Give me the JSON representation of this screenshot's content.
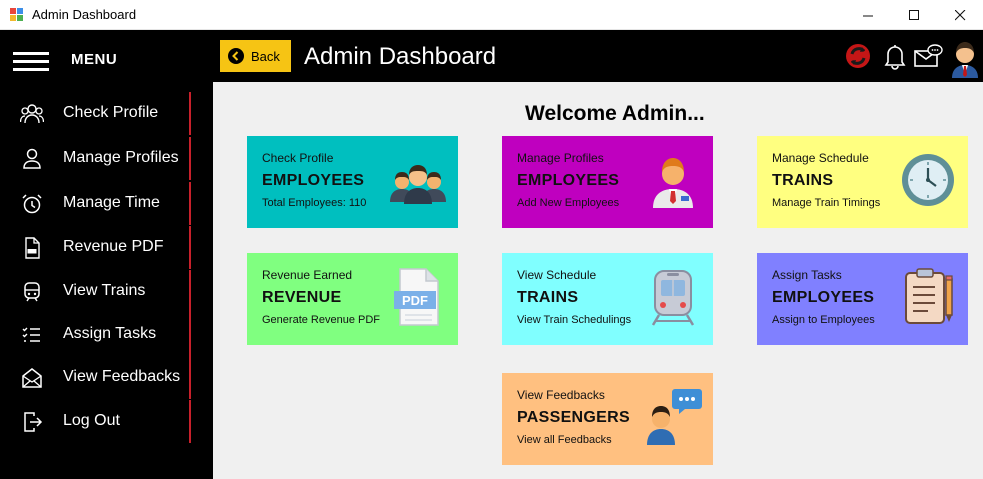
{
  "window": {
    "title": "Admin Dashboard"
  },
  "sidebar": {
    "menu_label": "MENU",
    "items": [
      {
        "label": "Check Profile",
        "icon": "people-icon"
      },
      {
        "label": "Manage Profiles",
        "icon": "user-icon"
      },
      {
        "label": "Manage Time",
        "icon": "alarm-clock-icon"
      },
      {
        "label": "Revenue PDF",
        "icon": "pdf-file-icon"
      },
      {
        "label": "View Trains",
        "icon": "train-icon"
      },
      {
        "label": "Assign Tasks",
        "icon": "task-list-icon"
      },
      {
        "label": "View Feedbacks",
        "icon": "envelope-icon"
      },
      {
        "label": "Log Out",
        "icon": "logout-icon"
      }
    ],
    "accent_color": "#c8202b"
  },
  "header": {
    "back_label": "Back",
    "title": "Admin Dashboard",
    "back_color": "#f6c414"
  },
  "main": {
    "welcome": "Welcome Admin...",
    "cards": [
      {
        "subtitle": "Check Profile",
        "heading": "EMPLOYEES",
        "description": "Total Employees: 110",
        "color": "#00bfbf",
        "icon": "employees-group-icon"
      },
      {
        "subtitle": "Manage Profiles",
        "heading": "EMPLOYEES",
        "description": "Add New Employees",
        "color": "#bf00bf",
        "icon": "employee-avatar-icon"
      },
      {
        "subtitle": "Manage Schedule",
        "heading": "TRAINS",
        "description": "Manage Train Timings",
        "color": "#ffff80",
        "icon": "wall-clock-icon"
      },
      {
        "subtitle": "Revenue Earned",
        "heading": "REVENUE",
        "description": "Generate Revenue PDF",
        "color": "#80ff80",
        "icon": "pdf-document-icon"
      },
      {
        "subtitle": "View Schedule",
        "heading": "TRAINS",
        "description": "View Train Schedulings",
        "color": "#80ffff",
        "icon": "train-front-icon"
      },
      {
        "subtitle": "Assign Tasks",
        "heading": "EMPLOYEES",
        "description": "Assign to Employees",
        "color": "#8080ff",
        "icon": "clipboard-icon"
      },
      {
        "subtitle": "View Feedbacks",
        "heading": "PASSENGERS",
        "description": "View all Feedbacks",
        "color": "#ffc080",
        "icon": "chat-person-icon"
      }
    ],
    "background": "#f0f0f0"
  },
  "pdf_badge": "PDF"
}
